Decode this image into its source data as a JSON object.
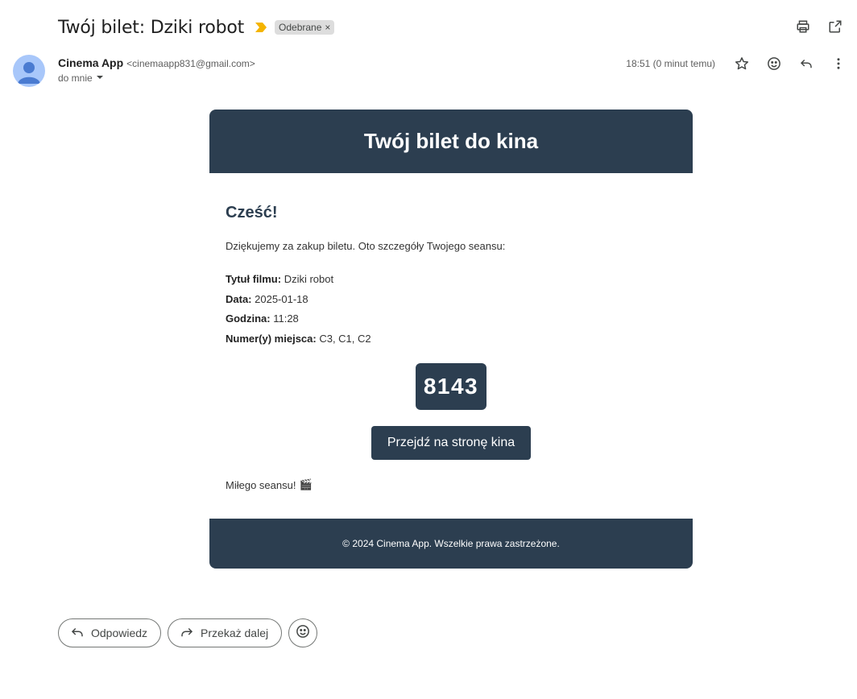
{
  "subject": {
    "title": "Twój bilet: Dziki robot",
    "label": "Odebrane",
    "label_close": "×"
  },
  "sender": {
    "name": "Cinema App",
    "email": "<cinemaapp831@gmail.com>",
    "to": "do mnie",
    "timestamp": "18:51 (0 minut temu)"
  },
  "email": {
    "header_title": "Twój bilet do kina",
    "greeting": "Cześć!",
    "intro": "Dziękujemy za zakup biletu. Oto szczegóły Twojego seansu:",
    "details": [
      {
        "label": "Tytuł filmu:",
        "value": " Dziki robot"
      },
      {
        "label": "Data:",
        "value": " 2025-01-18"
      },
      {
        "label": "Godzina:",
        "value": " 11:28"
      },
      {
        "label": "Numer(y) miejsca:",
        "value": " C3, C1, C2"
      }
    ],
    "ticket_code": "8143",
    "cta_label": "Przejdź na stronę kina",
    "closing": "Miłego seansu!",
    "closing_emoji": "🎬",
    "footer": "© 2024 Cinema App. Wszelkie prawa zastrzeżone."
  },
  "actions": {
    "reply": "Odpowiedz",
    "forward": "Przekaż dalej"
  },
  "colors": {
    "brand": "#2c3e50",
    "importance": "#f4b400",
    "avatar": "#a8c7fa"
  },
  "icons": {
    "importance": "importance-marker-icon",
    "print": "print-icon",
    "open_new_window": "open-in-new-window-icon",
    "star": "star-icon",
    "emoji": "emoji-reaction-icon",
    "reply": "reply-icon",
    "more": "more-vert-icon",
    "forward": "forward-icon",
    "dropdown": "chevron-down-icon"
  }
}
